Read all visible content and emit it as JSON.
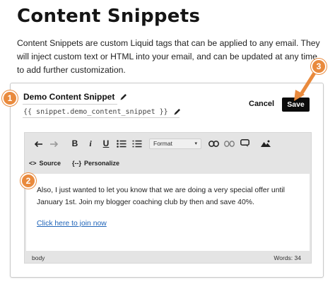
{
  "page": {
    "title": "Content Snippets",
    "intro": "Content Snippets are custom Liquid tags that can be applied to any email. They will inject custom text or HTML into your email, and can be updated at any time to add further customization."
  },
  "snippet": {
    "name": "Demo Content Snippet",
    "tag": "{{ snippet.demo_content_snippet }}"
  },
  "actions": {
    "cancel_label": "Cancel",
    "save_label": "Save"
  },
  "editor": {
    "toolbar": {
      "format_label": "Format",
      "bold": "B",
      "italic": "i",
      "underline": "U",
      "source_label": "Source",
      "personalize_label": "Personalize"
    },
    "body_text": "Also, I just wanted to let you know that we are doing a very special offer until January 1st. Join my blogger coaching club by then and save 40%.",
    "link_text": "Click here to join now",
    "status_path": "body",
    "word_count": "Words: 34"
  },
  "callouts": {
    "one": "1",
    "two": "2",
    "three": "3"
  },
  "colors": {
    "accent": "#e98a3d",
    "save_bg": "#0b0b0b",
    "link": "#1f64b8"
  }
}
